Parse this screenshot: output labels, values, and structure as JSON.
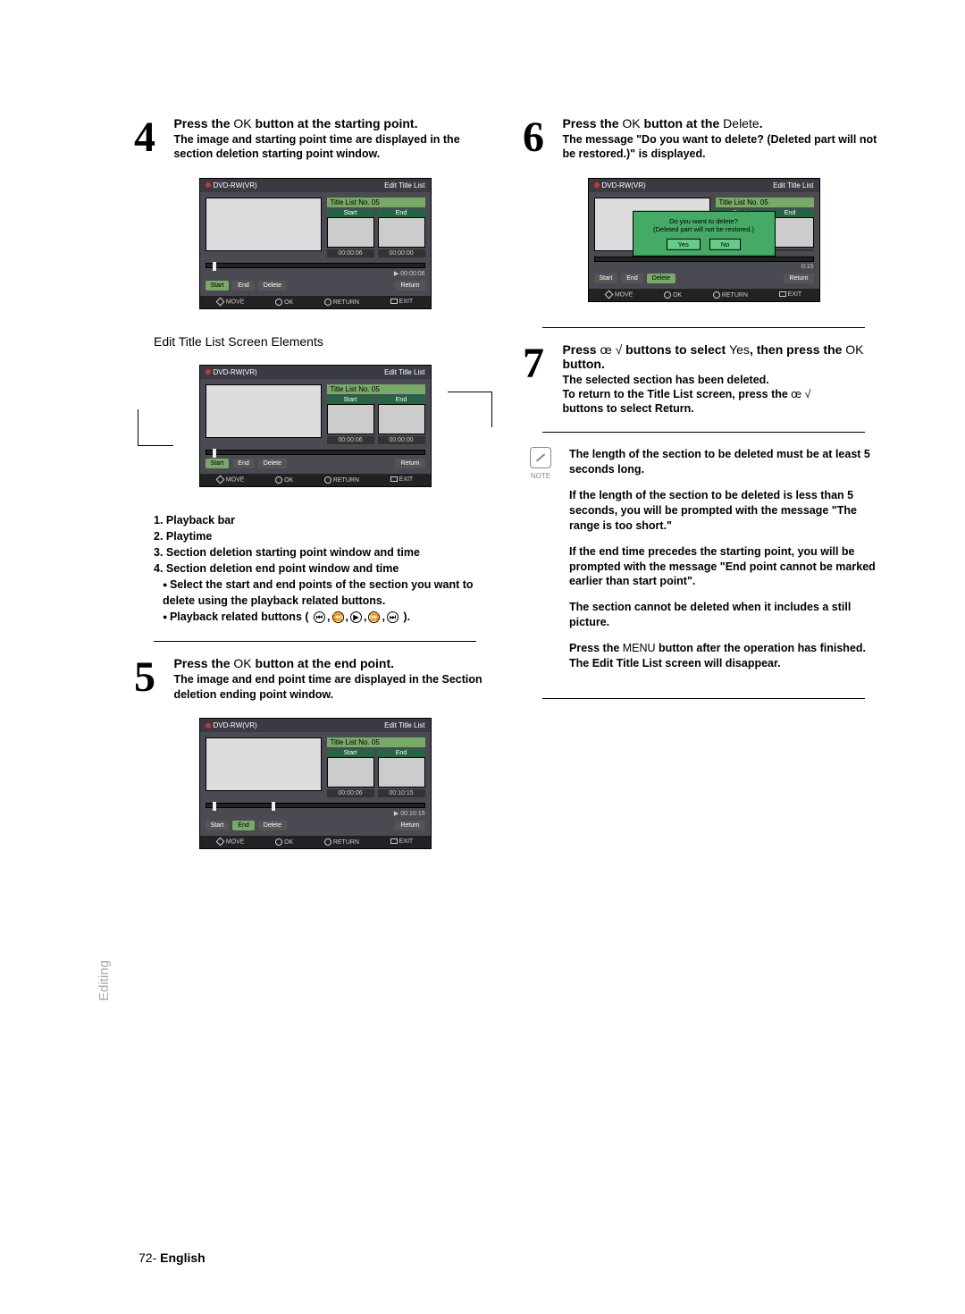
{
  "steps": {
    "s4": {
      "num": "4",
      "head_pre": "Press the ",
      "head_ok": "OK",
      "head_post": " button at the starting point.",
      "sub": "The image and starting point time are displayed in the section deletion starting point window."
    },
    "s5": {
      "num": "5",
      "head_pre": "Press the ",
      "head_ok": "OK",
      "head_post": " button at the end point.",
      "sub": "The image and end point time are displayed in the Section deletion ending point window."
    },
    "s6": {
      "num": "6",
      "head_pre": "Press the ",
      "head_ok": "OK",
      "head_mid": " button at the ",
      "head_del": "Delete",
      "head_post": ".",
      "sub": "The message \"Do you want to delete? (Deleted part will not be restored.)\" is displayed."
    },
    "s7": {
      "num": "7",
      "head_pre": "Press ",
      "head_dir": "œ √",
      "head_mid": " buttons to select ",
      "head_yes": "Yes",
      "head_mid2": ", then press the ",
      "head_ok": "OK",
      "head_post": " button.",
      "sub1": "The selected section has been deleted.",
      "sub2_pre": "To return to the Title List screen, press the ",
      "sub2_dir": "œ √",
      "sub3": "buttons to select Return."
    }
  },
  "subtitle": "Edit Title List Screen Elements",
  "elements_list": {
    "i1": "1. Playback bar",
    "i2": "2. Playtime",
    "i3": "3. Section deletion starting point window and time",
    "i4": "4. Section deletion end point window and time",
    "b1": "Select the start and end points of the section you want to delete using the playback related buttons.",
    "b2": "Playback related buttons ( "
  },
  "note": {
    "label": "NOTE",
    "p1": "The length of the section to be deleted must be at least 5 seconds long.",
    "p2": "If the length of the section to be deleted is less than 5 seconds, you will be prompted with the message \"The range is too short.\"",
    "p3": "If the end time precedes the starting point, you will be prompted with the message \"End point cannot be marked earlier than start point\".",
    "p4": "The section cannot be deleted when it includes a still picture.",
    "p5_pre": "Press the ",
    "p5_menu": "MENU",
    "p5_post": " button after the operation has finished. The Edit Title List screen will disappear."
  },
  "screens": {
    "disc": "DVD-RW(VR)",
    "title": "Edit Title List",
    "tlno": "Title List No. 05",
    "start": "Start",
    "end": "End",
    "delete": "Delete",
    "return": "Return",
    "move": "MOVE",
    "ok": "OK",
    "ret": "RETURN",
    "exit": "EXIT",
    "s4": {
      "t1": "00:00:06",
      "t2": "00:00:00",
      "bartime": "00:00:06"
    },
    "s4b": {
      "tlno": "Title List No. 05",
      "t1": "00:00:06",
      "t2": "00:00:00"
    },
    "s5": {
      "t1": "00:00:06",
      "t2": "00:10:15",
      "bartime": "00:10:15"
    },
    "dialog": {
      "line1": "Do you want to delete?",
      "line2": "(Deleted part will not be restored.)",
      "yes": "Yes",
      "no": "No"
    },
    "sidetime": "0:15"
  },
  "side_label": "Editing",
  "page_num": "72-",
  "page_lang": "English"
}
